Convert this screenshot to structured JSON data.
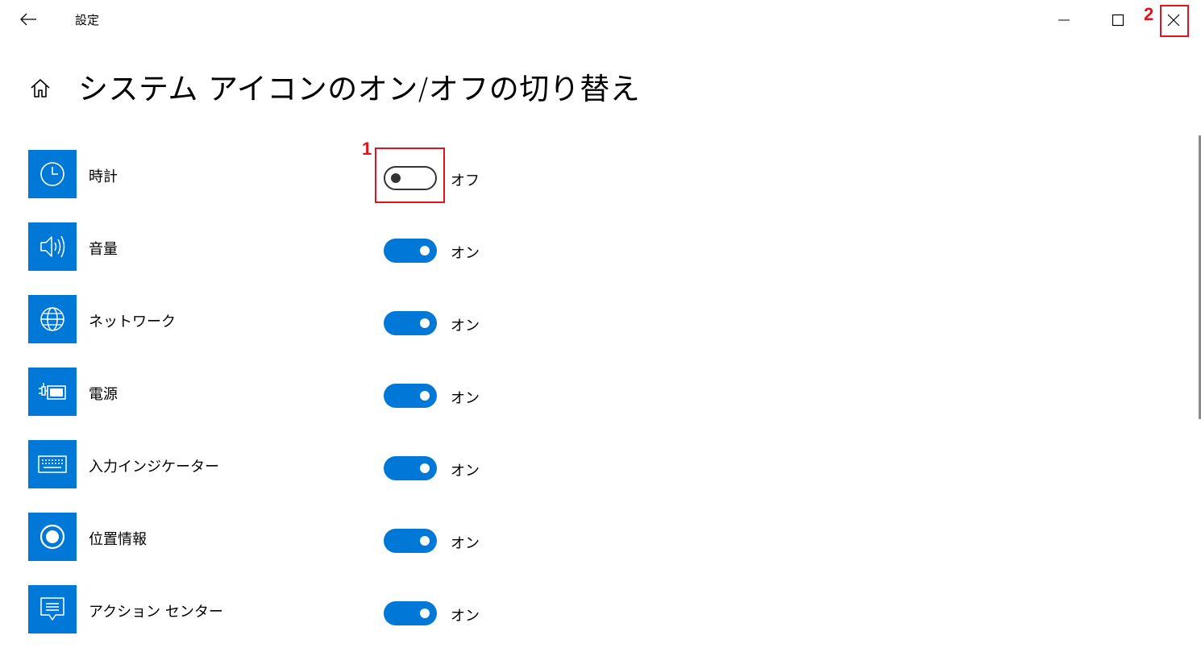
{
  "window": {
    "app_title": "設定"
  },
  "page": {
    "title": "システム アイコンのオン/オフの切り替え"
  },
  "callouts": {
    "one": "1",
    "two": "2",
    "color": "#e0141e"
  },
  "accent_color": "#0078d7",
  "items": [
    {
      "label": "時計",
      "icon": "clock-icon",
      "on": false,
      "state": "オフ"
    },
    {
      "label": "音量",
      "icon": "volume-icon",
      "on": true,
      "state": "オン"
    },
    {
      "label": "ネットワーク",
      "icon": "network-globe-icon",
      "on": true,
      "state": "オン"
    },
    {
      "label": "電源",
      "icon": "power-battery-icon",
      "on": true,
      "state": "オン"
    },
    {
      "label": "入力インジケーター",
      "icon": "keyboard-icon",
      "on": true,
      "state": "オン"
    },
    {
      "label": "位置情報",
      "icon": "location-icon",
      "on": true,
      "state": "オン"
    },
    {
      "label": "アクション センター",
      "icon": "action-center-icon",
      "on": true,
      "state": "オン"
    }
  ]
}
